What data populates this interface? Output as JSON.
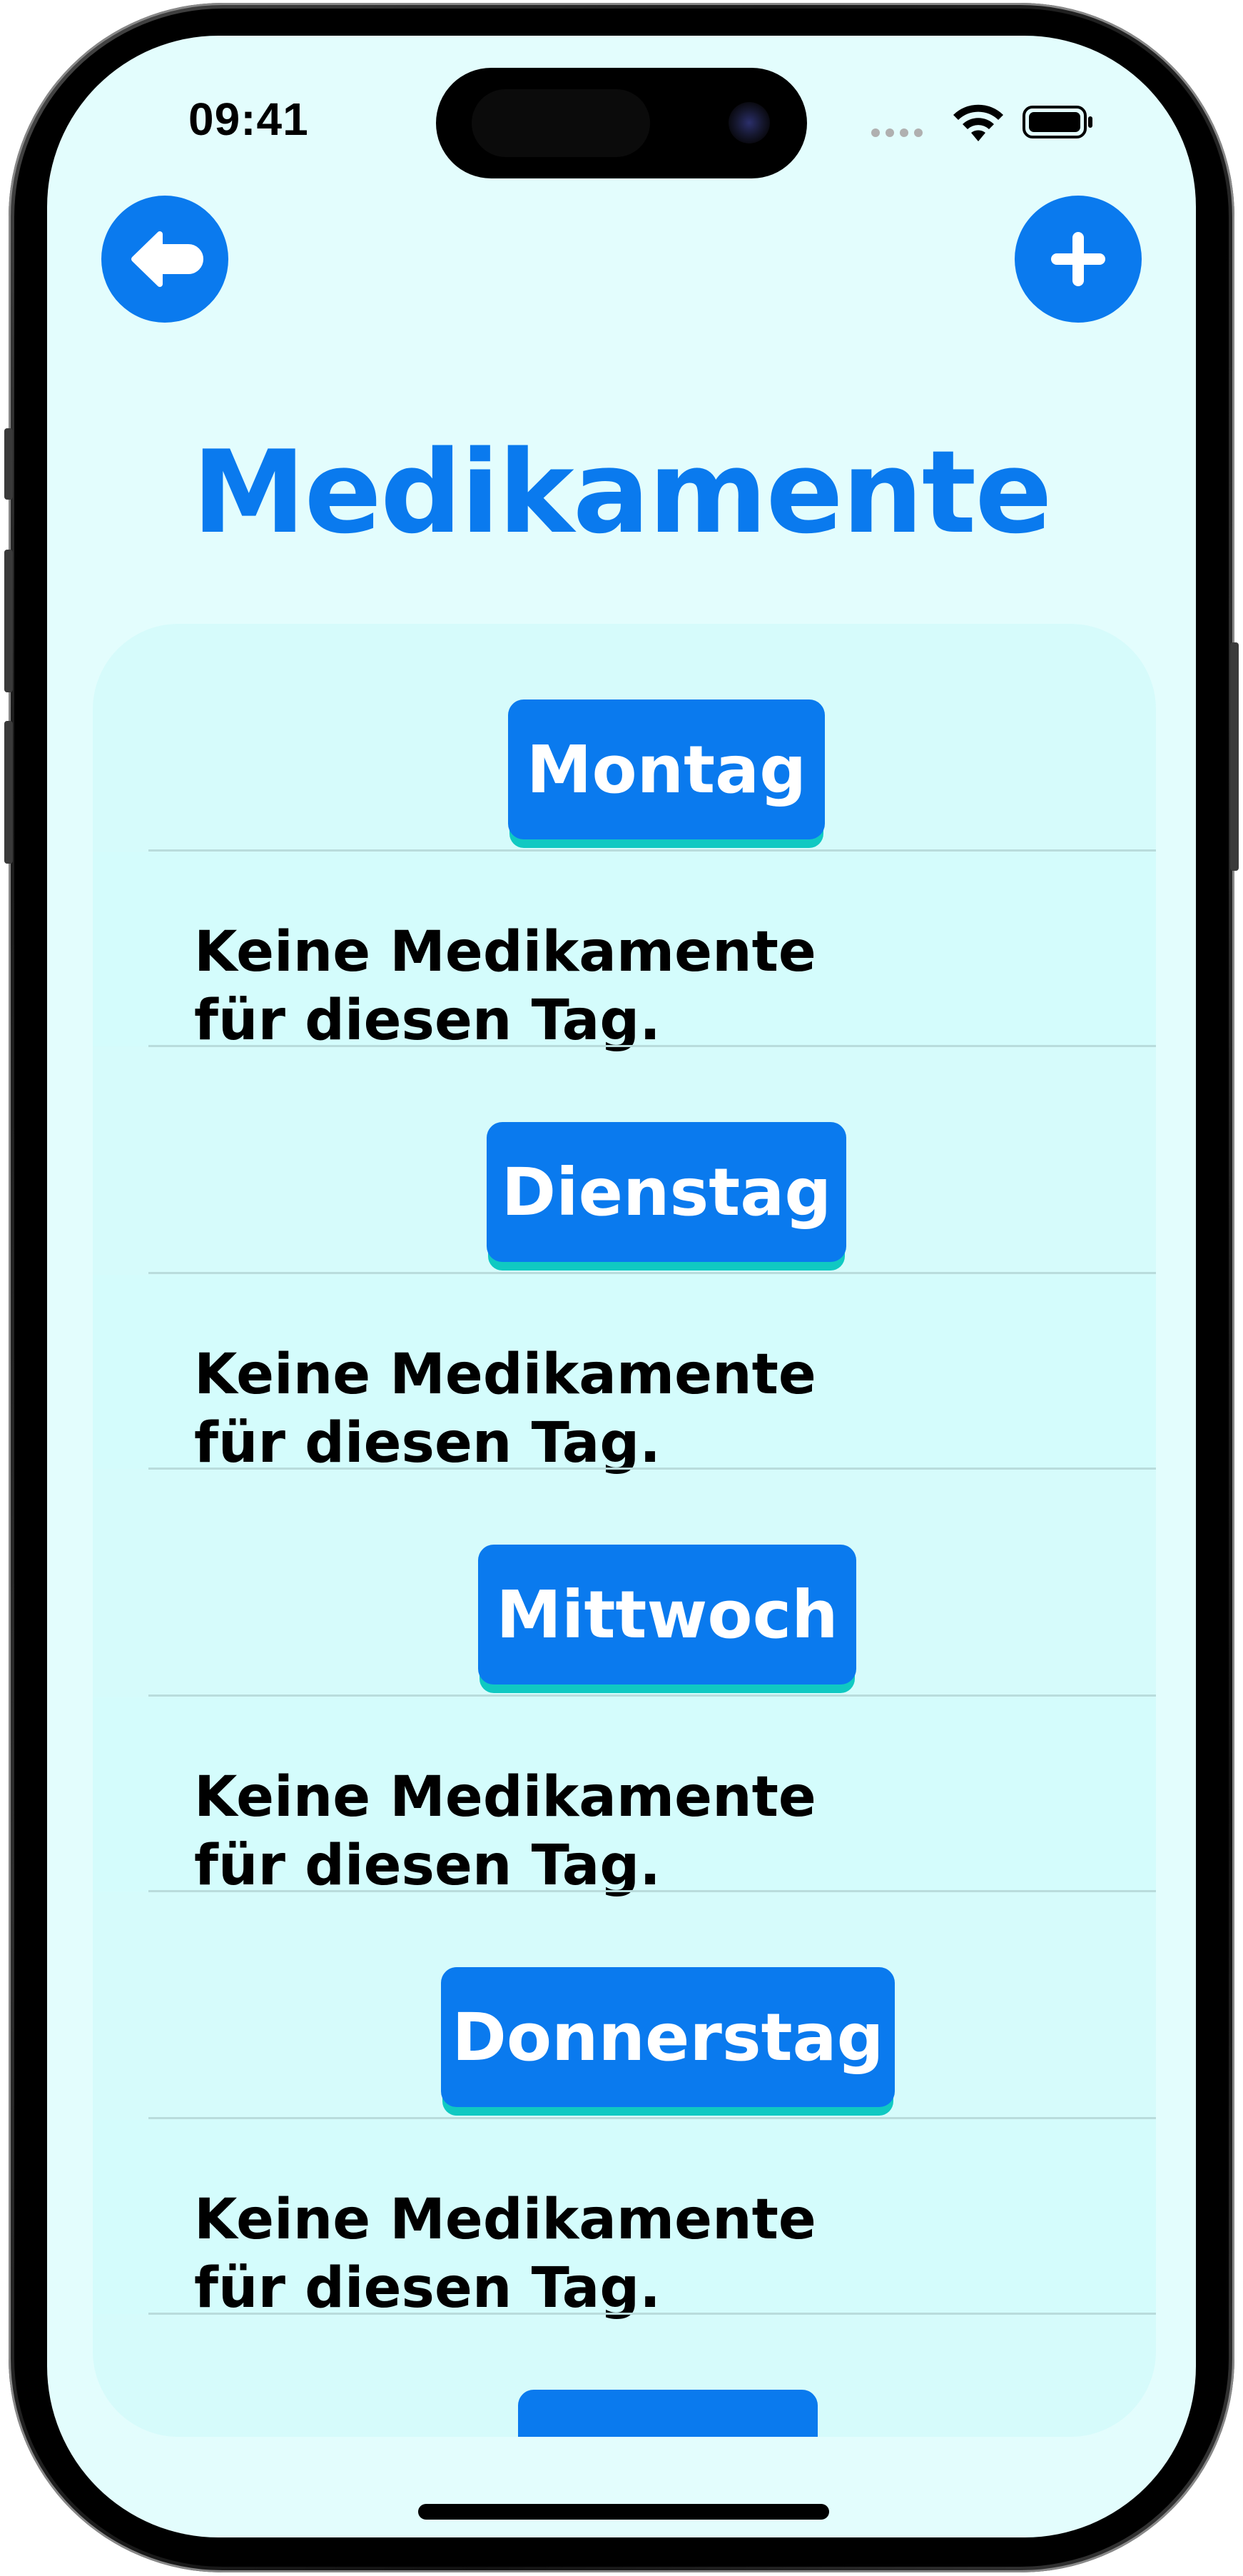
{
  "status_bar": {
    "time": "09:41"
  },
  "header": {
    "back_icon": "arrow-left-icon",
    "add_icon": "plus-icon",
    "title": "Medikamente"
  },
  "days": [
    {
      "label": "Montag",
      "empty_text": "Keine Medikamente für diesen Tag."
    },
    {
      "label": "Dienstag",
      "empty_text": "Keine Medikamente für diesen Tag."
    },
    {
      "label": "Mittwoch",
      "empty_text": "Keine Medikamente für diesen Tag."
    },
    {
      "label": "Donnerstag",
      "empty_text": "Keine Medikamente für diesen Tag."
    },
    {
      "label": ""
    }
  ],
  "colors": {
    "accent": "#0a7aee",
    "pill_shadow": "#10c9c2",
    "background": "#e3fdfd",
    "card": "#d6fbfb"
  }
}
